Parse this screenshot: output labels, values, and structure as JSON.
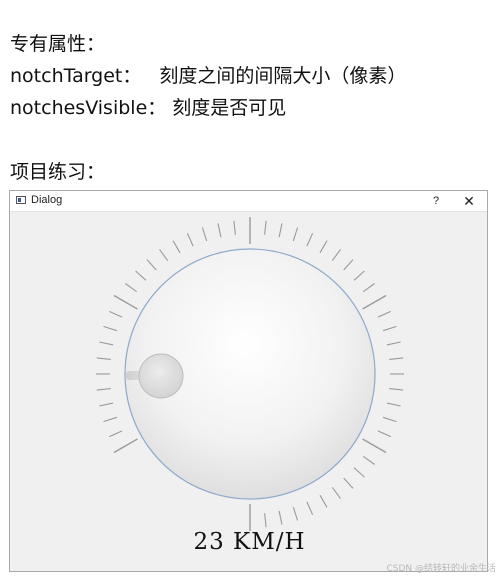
{
  "doc": {
    "line1": "专有属性：",
    "notchTarget": {
      "term": "notchTarget：",
      "desc": "刻度之间的间隔大小（像素）"
    },
    "notchesVisible": {
      "term": "notchesVisible：",
      "desc": "刻度是否可见"
    },
    "exercise": "项目练习："
  },
  "dialog": {
    "title": "Dialog",
    "help": "?",
    "close": "✕",
    "icon": "app-window-icon",
    "dial": {
      "notches_visible": true,
      "wrapping": false
    },
    "speed_readout": "23 KM/H"
  },
  "watermark": "CSDN @结转轩的业余生活",
  "colors": {
    "dialog_bg": "#f0f0f0",
    "knob_border": "#8eaacb",
    "notch": "#9a9a9a",
    "grip": "#d8d8d8"
  }
}
